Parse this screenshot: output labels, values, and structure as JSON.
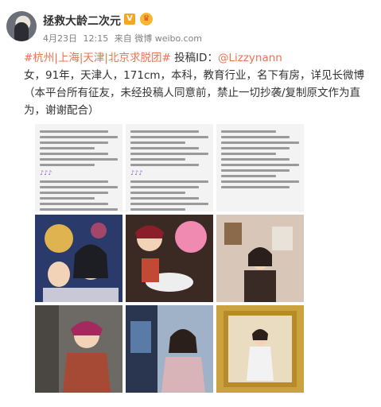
{
  "post": {
    "username": "拯救大龄二次元",
    "vip_badge": "V",
    "crown_badge": "♛",
    "date": "4月23日",
    "time": "12:15",
    "source": "来自 微博 weibo.com",
    "hashtags": "#杭州|上海|天津|北京求脱团#",
    "contributor_label": "投稿ID：",
    "contributor_handle": "@Lizzynann",
    "line2": "女，91年，天津人，171cm，本科，教育行业，名下有房，详见长微博",
    "line3": "（本平台所有征友，未经投稿人同意前，禁止一切抄袭/复制原文作为直",
    "line4": "为，谢谢配合）"
  },
  "images": [
    {
      "name": "image-1",
      "kind": "text-screenshot"
    },
    {
      "name": "image-2",
      "kind": "text-screenshot"
    },
    {
      "name": "image-3",
      "kind": "text-screenshot"
    },
    {
      "name": "image-4",
      "kind": "photo"
    },
    {
      "name": "image-5",
      "kind": "photo"
    },
    {
      "name": "image-6",
      "kind": "photo"
    },
    {
      "name": "image-7",
      "kind": "photo"
    },
    {
      "name": "image-8",
      "kind": "photo"
    },
    {
      "name": "image-9",
      "kind": "photo"
    }
  ],
  "colors": {
    "link": "#eb7350",
    "meta": "#808080",
    "username": "#333333"
  }
}
